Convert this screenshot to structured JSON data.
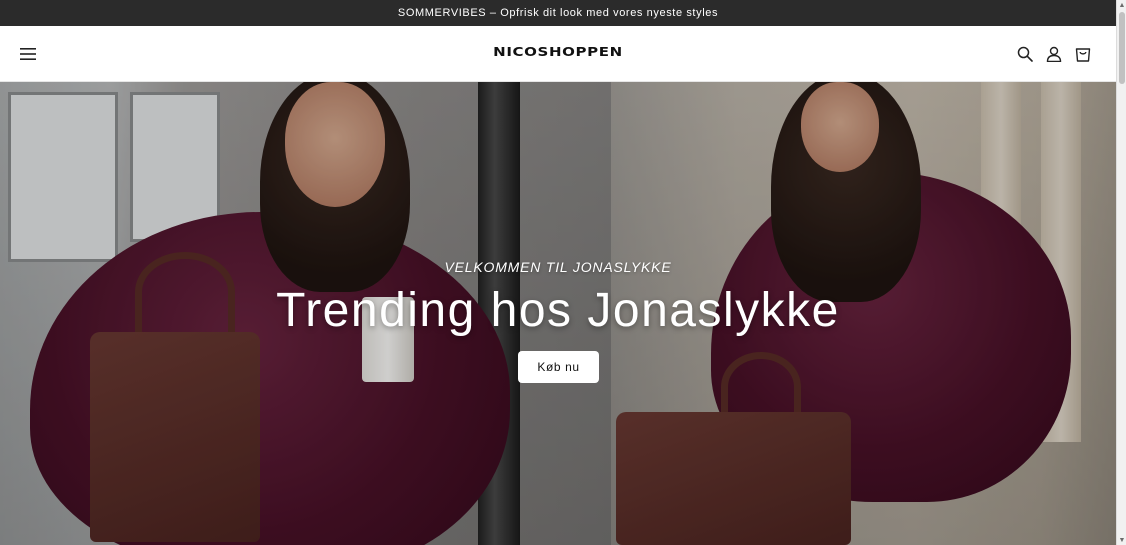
{
  "announcement": {
    "text": "SOMMERVIBES – Opfrisk dit look med vores nyeste styles"
  },
  "header": {
    "logo": "NICOSHOPPEN",
    "icons": {
      "menu": "hamburger-menu-icon",
      "search": "search-icon",
      "account": "account-icon",
      "cart": "cart-icon"
    }
  },
  "hero": {
    "subheading": "VELKOMMEN TIL JONASLYKKE",
    "heading": "Trending hos Jonaslykke",
    "button_label": "Køb nu"
  },
  "colors": {
    "announcement_bg": "#2b2b2b",
    "header_bg": "#ffffff",
    "hero_text": "#ffffff",
    "button_bg": "#ffffff",
    "button_text": "#111111"
  }
}
